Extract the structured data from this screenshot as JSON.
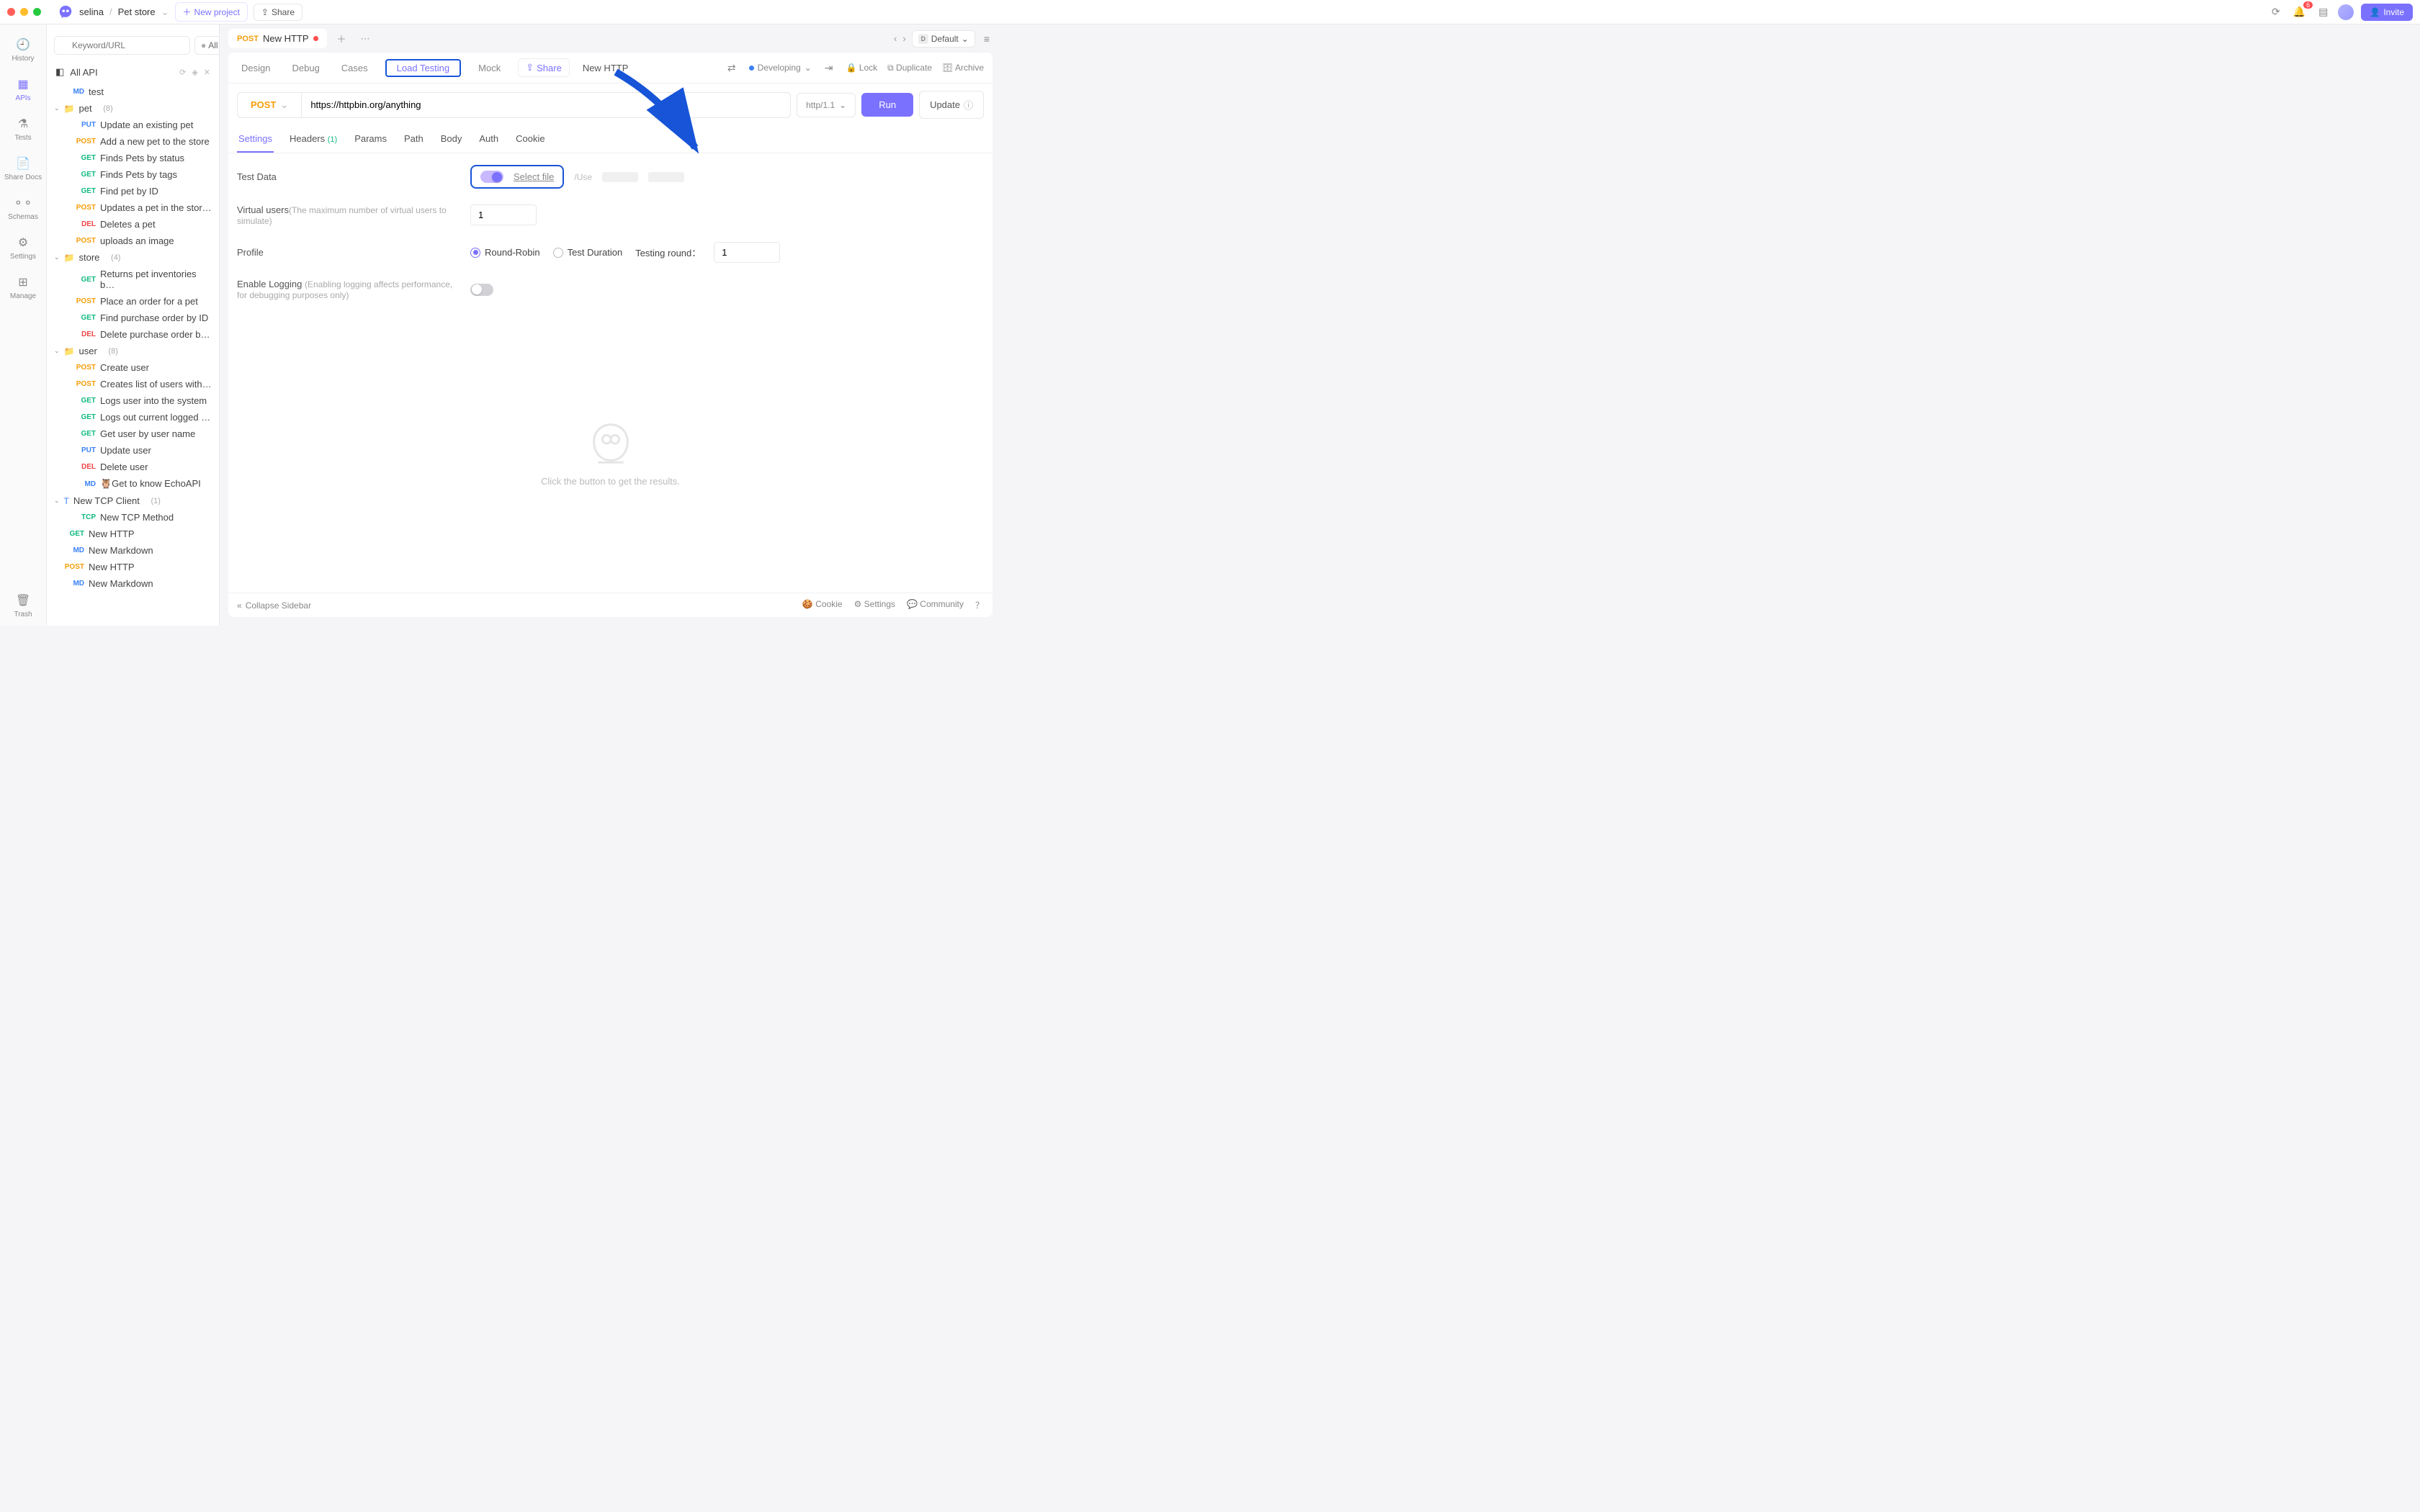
{
  "titlebar": {
    "workspace": "selina",
    "project": "Pet store",
    "new_project": "New project",
    "share": "Share",
    "invite": "Invite",
    "notif_count": "6"
  },
  "rail": {
    "history": "History",
    "apis": "APIs",
    "tests": "Tests",
    "share_docs": "Share Docs",
    "schemas": "Schemas",
    "settings": "Settings",
    "manage": "Manage",
    "trash": "Trash"
  },
  "tree": {
    "search_placeholder": "Keyword/URL",
    "all_label": "All",
    "all_api": "All API",
    "root_md": {
      "method": "MD",
      "name": "test"
    },
    "folders": [
      {
        "name": "pet",
        "count": "(8)",
        "items": [
          {
            "method": "PUT",
            "name": "Update an existing pet"
          },
          {
            "method": "POST",
            "name": "Add a new pet to the store"
          },
          {
            "method": "GET",
            "name": "Finds Pets by status"
          },
          {
            "method": "GET",
            "name": "Finds Pets by tags"
          },
          {
            "method": "GET",
            "name": "Find pet by ID"
          },
          {
            "method": "POST",
            "name": "Updates a pet in the stor…"
          },
          {
            "method": "DEL",
            "name": "Deletes a pet"
          },
          {
            "method": "POST",
            "name": "uploads an image"
          }
        ]
      },
      {
        "name": "store",
        "count": "(4)",
        "items": [
          {
            "method": "GET",
            "name": "Returns pet inventories b…"
          },
          {
            "method": "POST",
            "name": "Place an order for a pet"
          },
          {
            "method": "GET",
            "name": "Find purchase order by ID"
          },
          {
            "method": "DEL",
            "name": "Delete purchase order b…"
          }
        ]
      },
      {
        "name": "user",
        "count": "(8)",
        "items": [
          {
            "method": "POST",
            "name": "Create user"
          },
          {
            "method": "POST",
            "name": "Creates list of users with…"
          },
          {
            "method": "GET",
            "name": "Logs user into the system"
          },
          {
            "method": "GET",
            "name": "Logs out current logged …"
          },
          {
            "method": "GET",
            "name": "Get user by user name"
          },
          {
            "method": "PUT",
            "name": "Update user"
          },
          {
            "method": "DEL",
            "name": "Delete user"
          },
          {
            "method": "MD",
            "name": "🦉Get to know EchoAPI"
          }
        ]
      }
    ],
    "tcp_folder": {
      "name": "New TCP Client",
      "count": "(1)",
      "items": [
        {
          "method": "TCP",
          "name": "New TCP Method"
        }
      ]
    },
    "loose_items": [
      {
        "method": "GET",
        "name": "New HTTP"
      },
      {
        "method": "MD",
        "name": "New Markdown"
      },
      {
        "method": "POST",
        "name": "New HTTP"
      },
      {
        "method": "MD",
        "name": "New Markdown"
      }
    ]
  },
  "doc": {
    "tab_method": "POST",
    "tab_name": "New HTTP",
    "env_letter": "D",
    "env_name": "Default"
  },
  "subtabs": {
    "design": "Design",
    "debug": "Debug",
    "cases": "Cases",
    "load_testing": "Load Testing",
    "mock": "Mock",
    "share": "Share",
    "current": "New HTTP",
    "status": "Developing",
    "lock": "Lock",
    "duplicate": "Duplicate",
    "archive": "Archive"
  },
  "request": {
    "method": "POST",
    "url": "https://httpbin.org/anything",
    "protocol": "http/1.1",
    "run": "Run",
    "update": "Update"
  },
  "req_tabs": {
    "settings": "Settings",
    "headers": "Headers",
    "headers_count": "(1)",
    "params": "Params",
    "path": "Path",
    "body": "Body",
    "auth": "Auth",
    "cookie": "Cookie"
  },
  "settings": {
    "test_data_label": "Test Data",
    "select_file": "Select file",
    "use_hint": "/Use",
    "virtual_users_label": "Virtual users",
    "virtual_users_hint": "(The maximum number of virtual users to simulate)",
    "virtual_users_value": "1",
    "profile_label": "Profile",
    "round_robin": "Round-Robin",
    "test_duration": "Test Duration",
    "testing_round_label": "Testing round：",
    "testing_round_value": "1",
    "enable_logging_label": "Enable Logging",
    "enable_logging_hint": "(Enabling logging affects performance, for debugging purposes only)"
  },
  "empty": {
    "msg": "Click the button to get the results."
  },
  "footer": {
    "collapse": "Collapse Sidebar",
    "cookie": "Cookie",
    "settings": "Settings",
    "community": "Community"
  }
}
